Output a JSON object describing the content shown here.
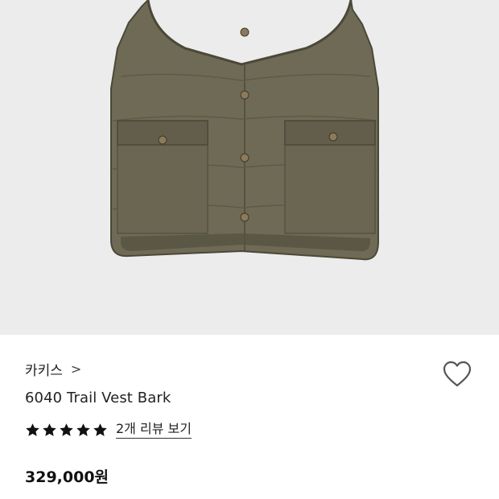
{
  "product": {
    "brand": "카키스",
    "brand_chevron": ">",
    "name": "6040 Trail Vest Bark",
    "rating_stars": 5,
    "review_link": "2개 리뷰 보기",
    "price": "329,000원"
  },
  "icons": {
    "brand_chevron": "chevron-right-icon",
    "wishlist": "heart-outline-icon",
    "star": "star-filled-icon"
  },
  "colors": {
    "image_bg": "#ececec",
    "vest": "#6e6a55",
    "vest_dark": "#4b4838",
    "star": "#111111",
    "heart_stroke": "#555555"
  }
}
